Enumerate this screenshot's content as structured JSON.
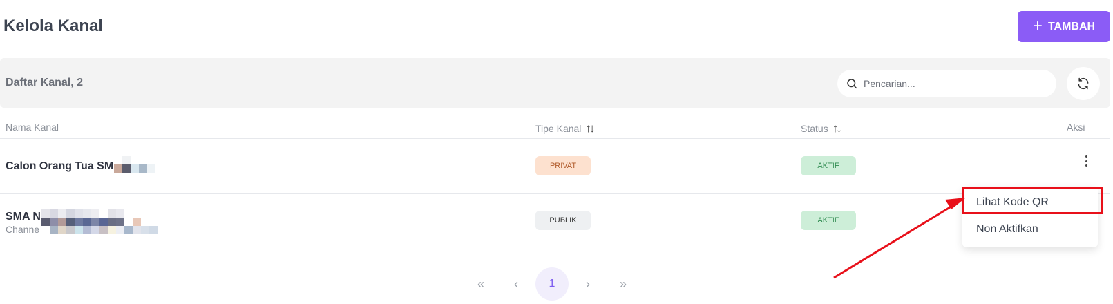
{
  "header": {
    "title": "Kelola Kanal",
    "add_button": "TAMBAH"
  },
  "toolbar": {
    "list_title": "Daftar Kanal, 2",
    "search_placeholder": "Pencarian..."
  },
  "table": {
    "columns": {
      "name": "Nama Kanal",
      "type": "Tipe Kanal",
      "status": "Status",
      "action": "Aksi"
    },
    "rows": [
      {
        "name": "Calon Orang Tua SM",
        "subtitle": "",
        "type": "PRIVAT",
        "status": "AKTIF"
      },
      {
        "name": "SMA N",
        "subtitle": "Channe",
        "type": "PUBLIK",
        "status": "AKTIF"
      }
    ]
  },
  "context_menu": {
    "items": [
      "Lihat Kode QR",
      "Non Aktifkan"
    ]
  },
  "pagination": {
    "first": "«",
    "prev": "‹",
    "current": "1",
    "next": "›",
    "last": "»"
  },
  "colors": {
    "accent": "#8b5cf6",
    "annotation": "#e8101a"
  },
  "icons": [
    "plus-icon",
    "search-icon",
    "refresh-icon",
    "sort-icon",
    "kebab-icon"
  ]
}
